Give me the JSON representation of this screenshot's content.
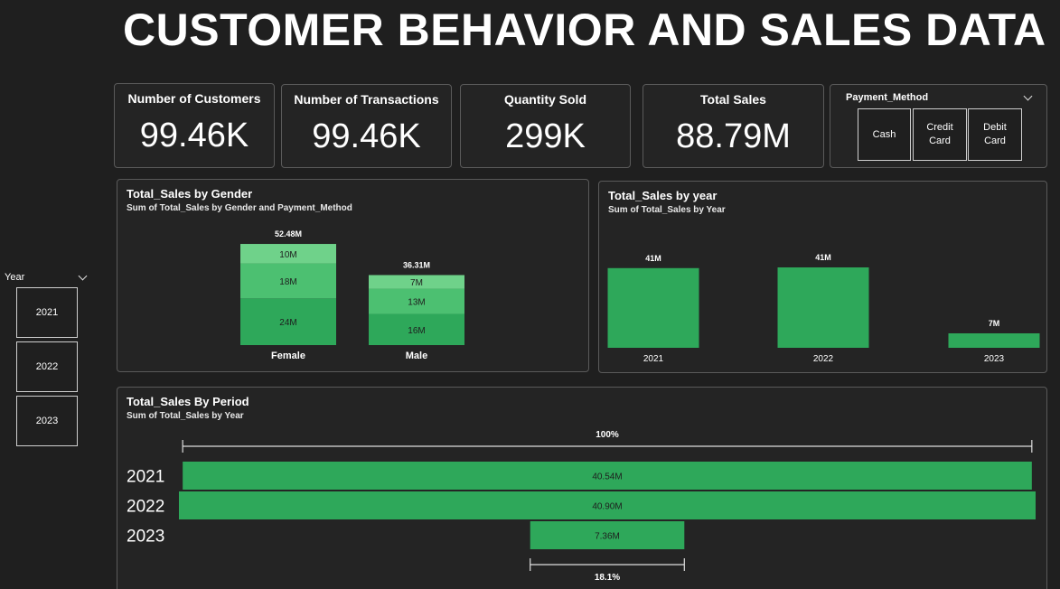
{
  "title": "CUSTOMER BEHAVIOR AND SALES DATA",
  "kpis": [
    {
      "label": "Number of Customers",
      "value": "99.46K"
    },
    {
      "label": "Number of Transactions",
      "value": "99.46K"
    },
    {
      "label": "Quantity Sold",
      "value": "299K"
    },
    {
      "label": "Total Sales",
      "value": "88.79M"
    }
  ],
  "payment_slicer": {
    "title": "Payment_Method",
    "options": [
      "Cash",
      "Credit\nCard",
      "Debit\nCard"
    ]
  },
  "year_slicer": {
    "title": "Year",
    "options": [
      "2021",
      "2022",
      "2023"
    ]
  },
  "colors": {
    "shade1": "#2ea85a",
    "shade2": "#4cc071",
    "shade3": "#6fd28a",
    "bar": "#2ea85a",
    "card_bg": "#242424",
    "border": "#5a5a5a"
  },
  "chart_data": [
    {
      "type": "bar",
      "stacked": true,
      "title": "Total_Sales by Gender",
      "subtitle": "Sum of Total_Sales by Gender and Payment_Method",
      "categories": [
        "Female",
        "Male"
      ],
      "totals": [
        "52.48M",
        "36.31M"
      ],
      "series": [
        {
          "values": [
            24,
            16
          ],
          "labels": [
            "24M",
            "16M"
          ]
        },
        {
          "values": [
            18,
            13
          ],
          "labels": [
            "18M",
            "13M"
          ]
        },
        {
          "values": [
            10,
            7
          ],
          "labels": [
            "10M",
            "7M"
          ]
        }
      ],
      "ylim": [
        0,
        52.48
      ]
    },
    {
      "type": "bar",
      "title": "Total_Sales by year",
      "subtitle": "Sum of Total_Sales by Year",
      "categories": [
        "2021",
        "2022",
        "2023"
      ],
      "values": [
        40.54,
        40.9,
        7.36
      ],
      "labels": [
        "41M",
        "41M",
        "7M"
      ],
      "ylim": [
        0,
        40.9
      ]
    },
    {
      "type": "funnel",
      "title": "Total_Sales By Period",
      "subtitle": "Sum of Total_Sales by Year",
      "categories": [
        "2021",
        "2022",
        "2023"
      ],
      "values": [
        40.54,
        40.9,
        7.36
      ],
      "labels": [
        "40.54M",
        "40.90M",
        "7.36M"
      ],
      "top_percent": "100%",
      "bottom_percent": "18.1%"
    }
  ]
}
